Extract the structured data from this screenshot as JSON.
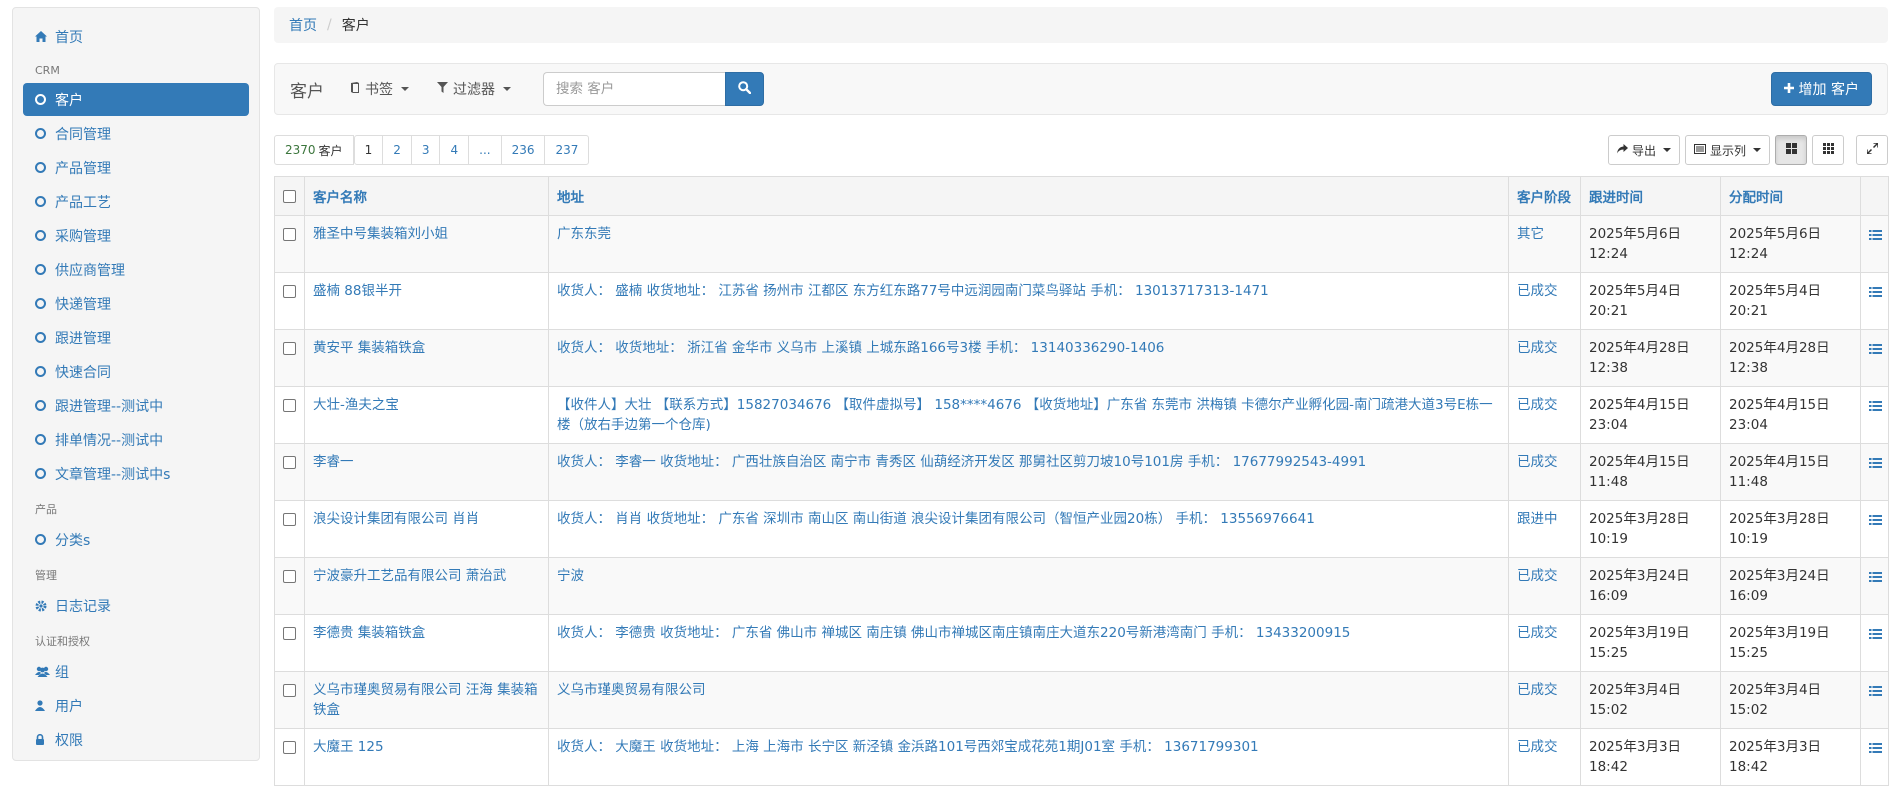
{
  "sidebar": {
    "home": "首页",
    "section_crm": "CRM",
    "crm_items": [
      "客户",
      "合同管理",
      "产品管理",
      "产品工艺",
      "采购管理",
      "供应商管理",
      "快递管理",
      "跟进管理",
      "快速合同",
      "跟进管理--测试中",
      "排单情况--测试中",
      "文章管理--测试中s"
    ],
    "section_product": "产品",
    "product_items": [
      "分类s"
    ],
    "section_admin": "管理",
    "log": "日志记录",
    "section_auth": "认证和授权",
    "group": "组",
    "user": "用户",
    "perm": "权限"
  },
  "breadcrumb": {
    "home": "首页",
    "sep": "/",
    "current": "客户"
  },
  "toolbar": {
    "brand": "客户",
    "bookmarks": "书签",
    "filters": "过滤器",
    "search_placeholder": "搜索 客户",
    "add_label": "增加 客户"
  },
  "pager": {
    "count": "2370",
    "count_unit": "客户",
    "pages": [
      "1",
      "2",
      "3",
      "4",
      "...",
      "236",
      "237"
    ]
  },
  "tools": {
    "export": "导出",
    "columns": "显示列"
  },
  "table": {
    "headers": [
      "客户名称",
      "地址",
      "客户阶段",
      "跟进时间",
      "分配时间"
    ],
    "rows": [
      {
        "name": "雅圣中号集装箱刘小姐",
        "addr": "广东东莞",
        "stage": "其它",
        "follow": "2025年5月6日 12:24",
        "assign": "2025年5月6日 12:24"
      },
      {
        "name": "盛楠 88银半开",
        "addr": "收货人： 盛楠 收货地址： 江苏省 扬州市 江都区 东方红东路77号中远润园南门菜鸟驿站 手机： 13013717313-1471",
        "stage": "已成交",
        "follow": "2025年5月4日 20:21",
        "assign": "2025年5月4日 20:21"
      },
      {
        "name": "黄安平 集装箱铁盒",
        "addr": "收货人： 收货地址： 浙江省 金华市 义乌市 上溪镇 上城东路166号3楼 手机： 13140336290-1406",
        "stage": "已成交",
        "follow": "2025年4月28日 12:38",
        "assign": "2025年4月28日 12:38"
      },
      {
        "name": "大壮-渔夫之宝",
        "addr": "【收件人】大壮 【联系方式】15827034676 【取件虚拟号】 158****4676 【收货地址】广东省 东莞市 洪梅镇 卡德尔产业孵化园-南门疏港大道3号E栋一楼（放右手边第一个仓库)",
        "stage": "已成交",
        "follow": "2025年4月15日 23:04",
        "assign": "2025年4月15日 23:04"
      },
      {
        "name": "李睿一",
        "addr": "收货人： 李睿一 收货地址： 广西壮族自治区 南宁市 青秀区 仙葫经济开发区 那舅社区剪刀坡10号101房 手机： 17677992543-4991",
        "stage": "已成交",
        "follow": "2025年4月15日 11:48",
        "assign": "2025年4月15日 11:48"
      },
      {
        "name": "浪尖设计集团有限公司 肖肖",
        "addr": "收货人： 肖肖 收货地址： 广东省 深圳市 南山区 南山街道 浪尖设计集团有限公司（智恒产业园20栋） 手机： 13556976641",
        "stage": "跟进中",
        "follow": "2025年3月28日 10:19",
        "assign": "2025年3月28日 10:19"
      },
      {
        "name": "宁波豪升工艺品有限公司 萧治武",
        "addr": "宁波",
        "stage": "已成交",
        "follow": "2025年3月24日 16:09",
        "assign": "2025年3月24日 16:09"
      },
      {
        "name": "李德贵 集装箱铁盒",
        "addr": "收货人： 李德贵 收货地址： 广东省 佛山市 禅城区 南庄镇 佛山市禅城区南庄镇南庄大道东220号新港湾南门 手机： 13433200915",
        "stage": "已成交",
        "follow": "2025年3月19日 15:25",
        "assign": "2025年3月19日 15:25"
      },
      {
        "name": "义乌市瑾奥贸易有限公司 汪海 集装箱铁盒",
        "addr": "义乌市瑾奥贸易有限公司",
        "stage": "已成交",
        "follow": "2025年3月4日 15:02",
        "assign": "2025年3月4日 15:02"
      },
      {
        "name": "大魔王 125",
        "addr": "收货人： 大魔王 收货地址： 上海 上海市 长宁区 新泾镇 金浜路101号西郊宝成花苑1期J01室 手机： 13671799301",
        "stage": "已成交",
        "follow": "2025年3月3日 18:42",
        "assign": "2025年3月3日 18:42"
      }
    ]
  },
  "colors": {
    "primary": "#337ab7",
    "sidebar_bg": "#f5f5f5",
    "count_green": "#3c763d"
  }
}
